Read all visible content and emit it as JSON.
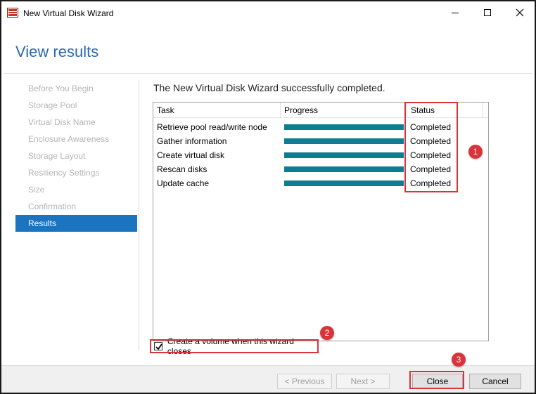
{
  "window": {
    "title": "New Virtual Disk Wizard",
    "controls": {
      "minimize": "—",
      "maximize": "☐",
      "close": "✕"
    }
  },
  "header": {
    "title": "View results"
  },
  "nav": {
    "items": [
      {
        "label": "Before You Begin",
        "active": false
      },
      {
        "label": "Storage Pool",
        "active": false
      },
      {
        "label": "Virtual Disk Name",
        "active": false
      },
      {
        "label": "Enclosure Awareness",
        "active": false
      },
      {
        "label": "Storage Layout",
        "active": false
      },
      {
        "label": "Resiliency Settings",
        "active": false
      },
      {
        "label": "Size",
        "active": false
      },
      {
        "label": "Confirmation",
        "active": false
      },
      {
        "label": "Results",
        "active": true
      }
    ]
  },
  "main": {
    "heading": "The New Virtual Disk Wizard successfully completed.",
    "table": {
      "columns": [
        "Task",
        "Progress",
        "Status"
      ],
      "rows": [
        {
          "task": "Retrieve pool read/write node",
          "progress": 1.0,
          "status": "Completed"
        },
        {
          "task": "Gather information",
          "progress": 1.0,
          "status": "Completed"
        },
        {
          "task": "Create virtual disk",
          "progress": 1.0,
          "status": "Completed"
        },
        {
          "task": "Rescan disks",
          "progress": 1.0,
          "status": "Completed"
        },
        {
          "task": "Update cache",
          "progress": 1.0,
          "status": "Completed"
        }
      ]
    },
    "checkbox": {
      "label": "Create a volume when this wizard closes",
      "checked": true
    }
  },
  "callouts": [
    "1",
    "2",
    "3"
  ],
  "footer": {
    "previous": "< Previous",
    "next": "Next >",
    "close": "Close",
    "cancel": "Cancel"
  },
  "colors": {
    "accent": "#1b74c0",
    "title_blue": "#2a6ab2",
    "progress": "#0e7c93",
    "callout": "#d9343a"
  }
}
